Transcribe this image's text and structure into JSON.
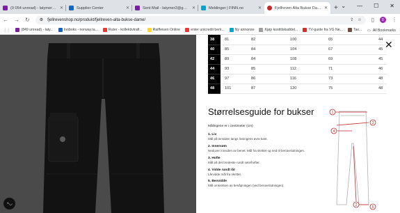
{
  "tabs": [
    {
      "title": "(9 054 unread) - latymer1@...",
      "color": "#7b1fa2",
      "active": false
    },
    {
      "title": "Supplier Center",
      "color": "#1565c0",
      "active": false
    },
    {
      "title": "Sent Mail - latymer2@gmail...",
      "color": "#7b1fa2",
      "active": false
    },
    {
      "title": "Meldinger | FINN.no",
      "color": "#0aa3ce",
      "active": false
    },
    {
      "title": "Fjellreven Alta Bukse Dame",
      "color": "#c62828",
      "active": true
    }
  ],
  "address_bar": {
    "url": "fjellrevenshop.no/produkt/fjellreven-alta-bukse-dame/",
    "profile_initial": "D"
  },
  "bookmarks": [
    {
      "label": "(849 unread) - laty...",
      "color": "#7b1fa2"
    },
    {
      "label": "Innboks - norway.ta...",
      "color": "#1565c0"
    },
    {
      "label": "Ruter - kollektivtrafi...",
      "color": "#e53935"
    },
    {
      "label": "Raiffeisen Online",
      "color": "#fdd835"
    },
    {
      "label": "enter unicredit berk...",
      "color": "#e53935"
    },
    {
      "label": "Ny annonse",
      "color": "#0aa3ce"
    },
    {
      "label": "Kjøp kosttilskuddet...",
      "color": "#9e9e9e"
    },
    {
      "label": "TV-guide fra VG Ne...",
      "color": "#d32f2f"
    },
    {
      "label": "Tax...",
      "color": "#6d4c41"
    }
  ],
  "all_bookmarks": "All Bookmarks",
  "size_table": {
    "rows": [
      [
        "38",
        "81",
        "82",
        "100",
        "65",
        "44"
      ],
      [
        "40",
        "85",
        "84",
        "104",
        "67",
        "45"
      ],
      [
        "42",
        "89",
        "84",
        "108",
        "69",
        "45"
      ],
      [
        "44",
        "93",
        "85",
        "112",
        "71",
        "46"
      ],
      [
        "46",
        "97",
        "86",
        "116",
        "73",
        "48"
      ],
      [
        "48",
        "101",
        "87",
        "120",
        "75",
        "48"
      ]
    ]
  },
  "guide": {
    "title": "Størrelsesguide for bukser",
    "intro": "Målingene er i centimeter (cm)",
    "measures": [
      {
        "title": "1. Liv",
        "desc": "Mål på innsiden langs livsingens øvre kant."
      },
      {
        "title": "2. Innersøm",
        "desc": "Nedover innsiden av benet. Mål fra skrittet og ned til benavslutningen."
      },
      {
        "title": "3. Hofte",
        "desc": "Mål på det bredeste rundt sete/hofter."
      },
      {
        "title": "4. Vidde rundt lår",
        "desc": "Lårvidde mål fra skrittet."
      },
      {
        "title": "5. Benvidde",
        "desc": "Mål omkretsen av benåpningen (ved benavslutningen)."
      }
    ],
    "diagram_labels": [
      "1",
      "2",
      "3",
      "4",
      "5"
    ]
  },
  "colors": {
    "accent": "#c62828",
    "modal_bg": "#ffffff",
    "photo_bg": "#4a4a4a"
  }
}
